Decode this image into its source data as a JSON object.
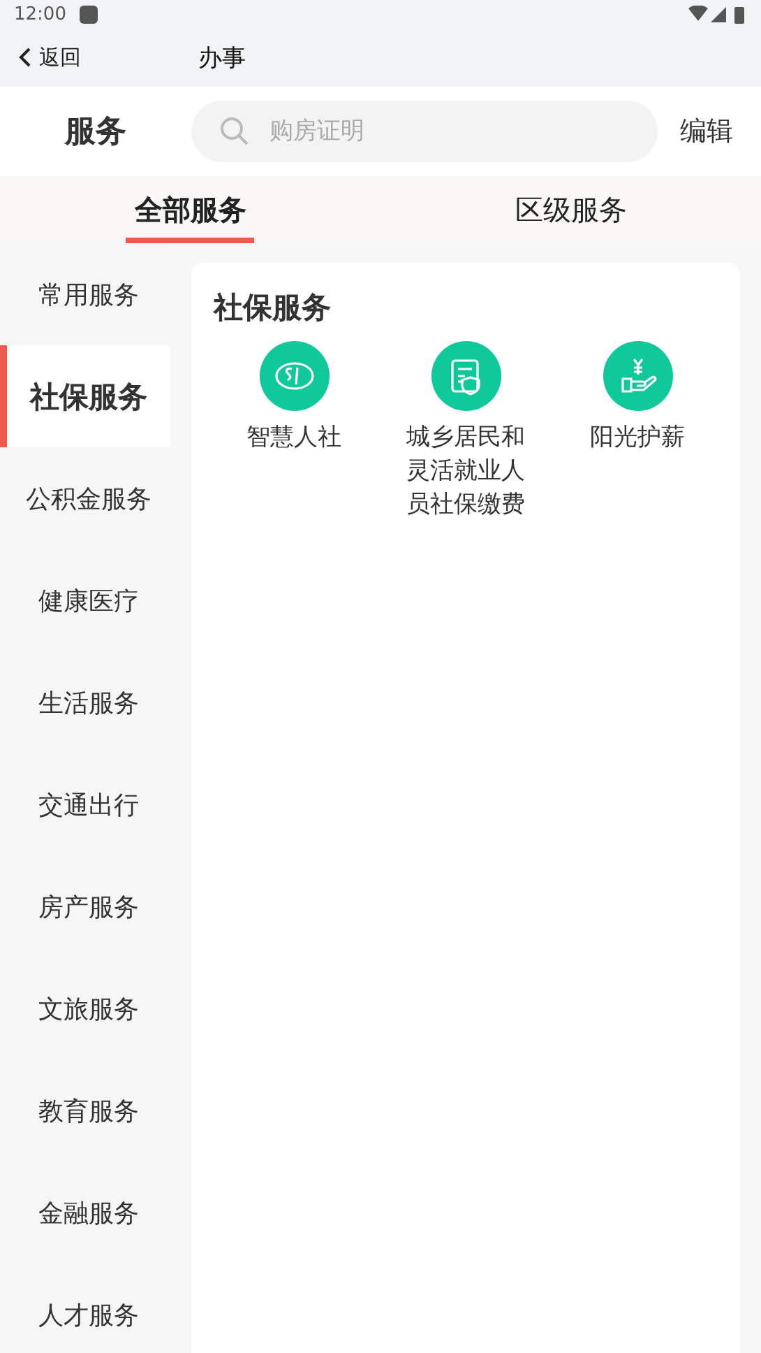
{
  "status_bar": {
    "time": "12:00"
  },
  "nav_bar": {
    "back_label": "返回",
    "title": "办事"
  },
  "search_row": {
    "title": "服务",
    "placeholder": "购房证明",
    "edit_label": "编辑"
  },
  "tabs": [
    {
      "label": "全部服务",
      "selected": true
    },
    {
      "label": "区级服务",
      "selected": false
    }
  ],
  "sidebar": {
    "items": [
      {
        "label": "常用服务",
        "selected": false
      },
      {
        "label": "社保服务",
        "selected": true
      },
      {
        "label": "公积金服务",
        "selected": false
      },
      {
        "label": "健康医疗",
        "selected": false
      },
      {
        "label": "生活服务",
        "selected": false
      },
      {
        "label": "交通出行",
        "selected": false
      },
      {
        "label": "房产服务",
        "selected": false
      },
      {
        "label": "文旅服务",
        "selected": false
      },
      {
        "label": "教育服务",
        "selected": false
      },
      {
        "label": "金融服务",
        "selected": false
      },
      {
        "label": "人才服务",
        "selected": false
      }
    ]
  },
  "section": {
    "title": "社保服务",
    "services": [
      {
        "label": "智慧人社",
        "kind": "card"
      },
      {
        "label": "城乡居民和灵活就业人员社保缴费",
        "kind": "document"
      },
      {
        "label": "阳光护薪",
        "kind": "salary"
      }
    ]
  }
}
